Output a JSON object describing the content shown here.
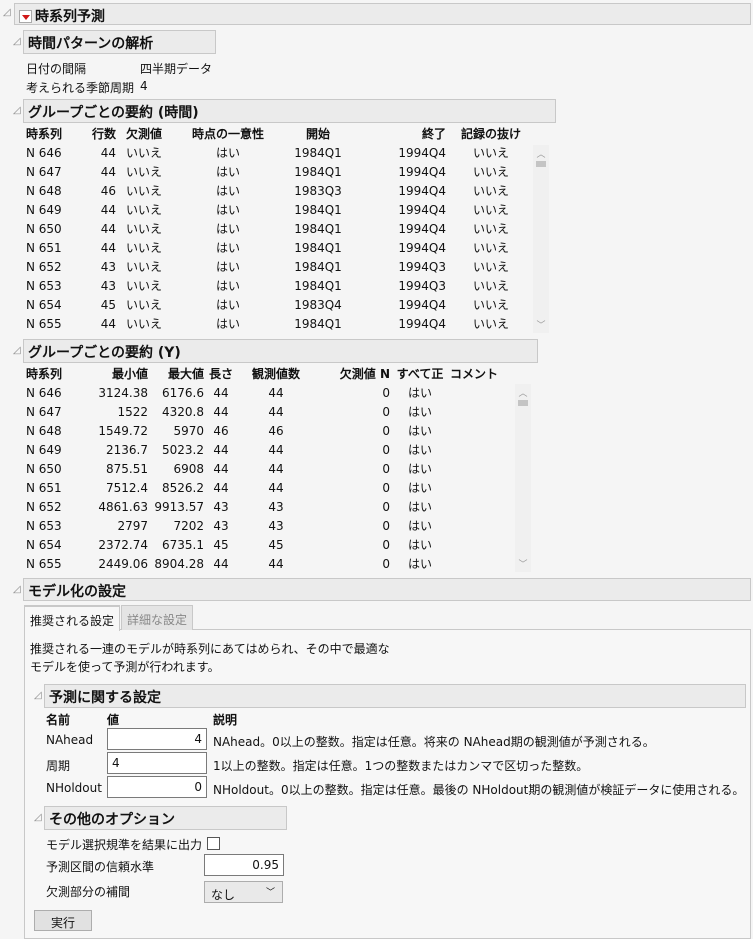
{
  "title": "時系列予測",
  "pattern": {
    "title": "時間パターンの解析",
    "rows": [
      {
        "label": "日付の間隔",
        "value": "四半期データ"
      },
      {
        "label": "考えられる季節周期",
        "value": "4"
      }
    ]
  },
  "time_summary": {
    "title": "グループごとの要約 (時間)",
    "headers": [
      "時系列",
      "行数",
      "欠測値",
      "時点の一意性",
      "開始",
      "終了",
      "記録の抜け"
    ],
    "rows": [
      [
        "N 646",
        "44",
        "いいえ",
        "はい",
        "1984Q1",
        "1994Q4",
        "いいえ"
      ],
      [
        "N 647",
        "44",
        "いいえ",
        "はい",
        "1984Q1",
        "1994Q4",
        "いいえ"
      ],
      [
        "N 648",
        "46",
        "いいえ",
        "はい",
        "1983Q3",
        "1994Q4",
        "いいえ"
      ],
      [
        "N 649",
        "44",
        "いいえ",
        "はい",
        "1984Q1",
        "1994Q4",
        "いいえ"
      ],
      [
        "N 650",
        "44",
        "いいえ",
        "はい",
        "1984Q1",
        "1994Q4",
        "いいえ"
      ],
      [
        "N 651",
        "44",
        "いいえ",
        "はい",
        "1984Q1",
        "1994Q4",
        "いいえ"
      ],
      [
        "N 652",
        "43",
        "いいえ",
        "はい",
        "1984Q1",
        "1994Q3",
        "いいえ"
      ],
      [
        "N 653",
        "43",
        "いいえ",
        "はい",
        "1984Q1",
        "1994Q3",
        "いいえ"
      ],
      [
        "N 654",
        "45",
        "いいえ",
        "はい",
        "1983Q4",
        "1994Q4",
        "いいえ"
      ],
      [
        "N 655",
        "44",
        "いいえ",
        "はい",
        "1984Q1",
        "1994Q4",
        "いいえ"
      ]
    ]
  },
  "y_summary": {
    "title": "グループごとの要約 (Y)",
    "headers": [
      "時系列",
      "最小値",
      "最大値",
      "長さ",
      "観測値数",
      "欠測値 N",
      "すべて正",
      "コメント"
    ],
    "rows": [
      [
        "N 646",
        "3124.38",
        "6176.6",
        "44",
        "44",
        "0",
        "はい",
        ""
      ],
      [
        "N 647",
        "1522",
        "4320.8",
        "44",
        "44",
        "0",
        "はい",
        ""
      ],
      [
        "N 648",
        "1549.72",
        "5970",
        "46",
        "46",
        "0",
        "はい",
        ""
      ],
      [
        "N 649",
        "2136.7",
        "5023.2",
        "44",
        "44",
        "0",
        "はい",
        ""
      ],
      [
        "N 650",
        "875.51",
        "6908",
        "44",
        "44",
        "0",
        "はい",
        ""
      ],
      [
        "N 651",
        "7512.4",
        "8526.2",
        "44",
        "44",
        "0",
        "はい",
        ""
      ],
      [
        "N 652",
        "4861.63",
        "9913.57",
        "43",
        "43",
        "0",
        "はい",
        ""
      ],
      [
        "N 653",
        "2797",
        "7202",
        "43",
        "43",
        "0",
        "はい",
        ""
      ],
      [
        "N 654",
        "2372.74",
        "6735.1",
        "45",
        "45",
        "0",
        "はい",
        ""
      ],
      [
        "N 655",
        "2449.06",
        "8904.28",
        "44",
        "44",
        "0",
        "はい",
        ""
      ]
    ]
  },
  "model": {
    "title": "モデル化の設定",
    "tabs": [
      "推奨される設定",
      "詳細な設定"
    ],
    "desc1": "推奨される一連のモデルが時系列にあてはめられ、その中で最適な",
    "desc2": "モデルを使って予測が行われます。",
    "forecast": {
      "title": "予測に関する設定",
      "headers": [
        "名前",
        "値",
        "説明"
      ],
      "rows": [
        {
          "name": "NAhead",
          "value": "4",
          "desc": "NAhead。0以上の整数。指定は任意。将来の NAhead期の観測値が予測される。"
        },
        {
          "name": "周期",
          "value": "4",
          "desc": "1以上の整数。指定は任意。1つの整数またはカンマで区切った整数。"
        },
        {
          "name": "NHoldout",
          "value": "0",
          "desc": "NHoldout。0以上の整数。指定は任意。最後の NHoldout期の観測値が検証データに使用される。"
        }
      ]
    },
    "other": {
      "title": "その他のオプション",
      "checkbox_label": "モデル選択規準を結果に出力",
      "conf_label": "予測区間の信頼水準",
      "conf_value": "0.95",
      "impute_label": "欠測部分の補間",
      "impute_value": "なし"
    },
    "run": "実行"
  }
}
